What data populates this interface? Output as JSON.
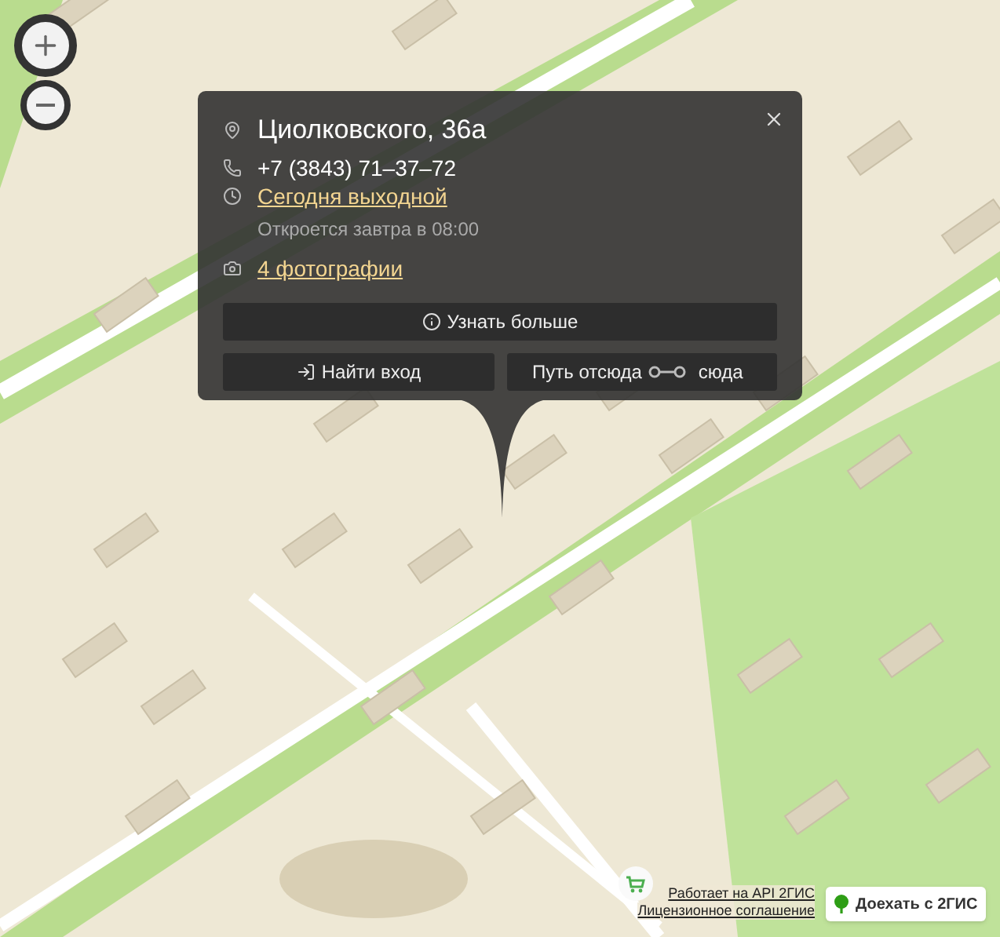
{
  "popup": {
    "address": "Циолковского, 36а",
    "phone": "+7 (3843) 71–37–72",
    "hours_status": "Сегодня выходной",
    "hours_note": "Откроется завтра в 08:00",
    "photos": "4 фотографии",
    "more_button": "Узнать больше",
    "entrance_button": "Найти вход",
    "route_from_button": "Путь отсюда",
    "route_to_button": "сюда"
  },
  "footer": {
    "api_link": "Работает на API 2ГИС",
    "license_link": "Лицензионное соглашение",
    "directions_button": "Доехать с 2ГИС"
  }
}
